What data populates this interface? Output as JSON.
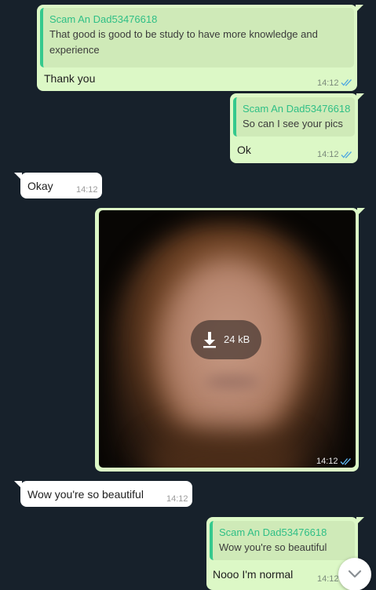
{
  "messages": [
    {
      "direction": "outgoing",
      "quote_author": "Scam An Dad53476618",
      "quote_text": "That good is good to be study to have more knowledge and experience",
      "text": "Thank you",
      "time": "14:12",
      "status": "read"
    },
    {
      "direction": "outgoing",
      "quote_author": "Scam An Dad53476618",
      "quote_text": "So can I see your pics",
      "text": "Ok",
      "time": "14:12",
      "status": "read"
    },
    {
      "direction": "incoming",
      "text": "Okay",
      "time": "14:12"
    },
    {
      "direction": "outgoing",
      "type": "photo",
      "download_size": "24 kB",
      "time": "14:12",
      "status": "read"
    },
    {
      "direction": "incoming",
      "text": "Wow you're so beautiful",
      "time": "14:12"
    },
    {
      "direction": "outgoing",
      "quote_author": "Scam An Dad53476618",
      "quote_text": "Wow you're so beautiful",
      "text": "Nooo I'm normal",
      "time": "14:12",
      "status": "read"
    }
  ],
  "icons": {
    "read_status": "double-check-icon",
    "download": "download-arrow-icon",
    "scroll_down": "chevron-down-icon"
  },
  "colors": {
    "background": "#17212b",
    "outgoing_bubble": "#dcf8c6",
    "incoming_bubble": "#ffffff",
    "quote_accent": "#35c98d",
    "read_ticks": "#4fa8e0"
  }
}
